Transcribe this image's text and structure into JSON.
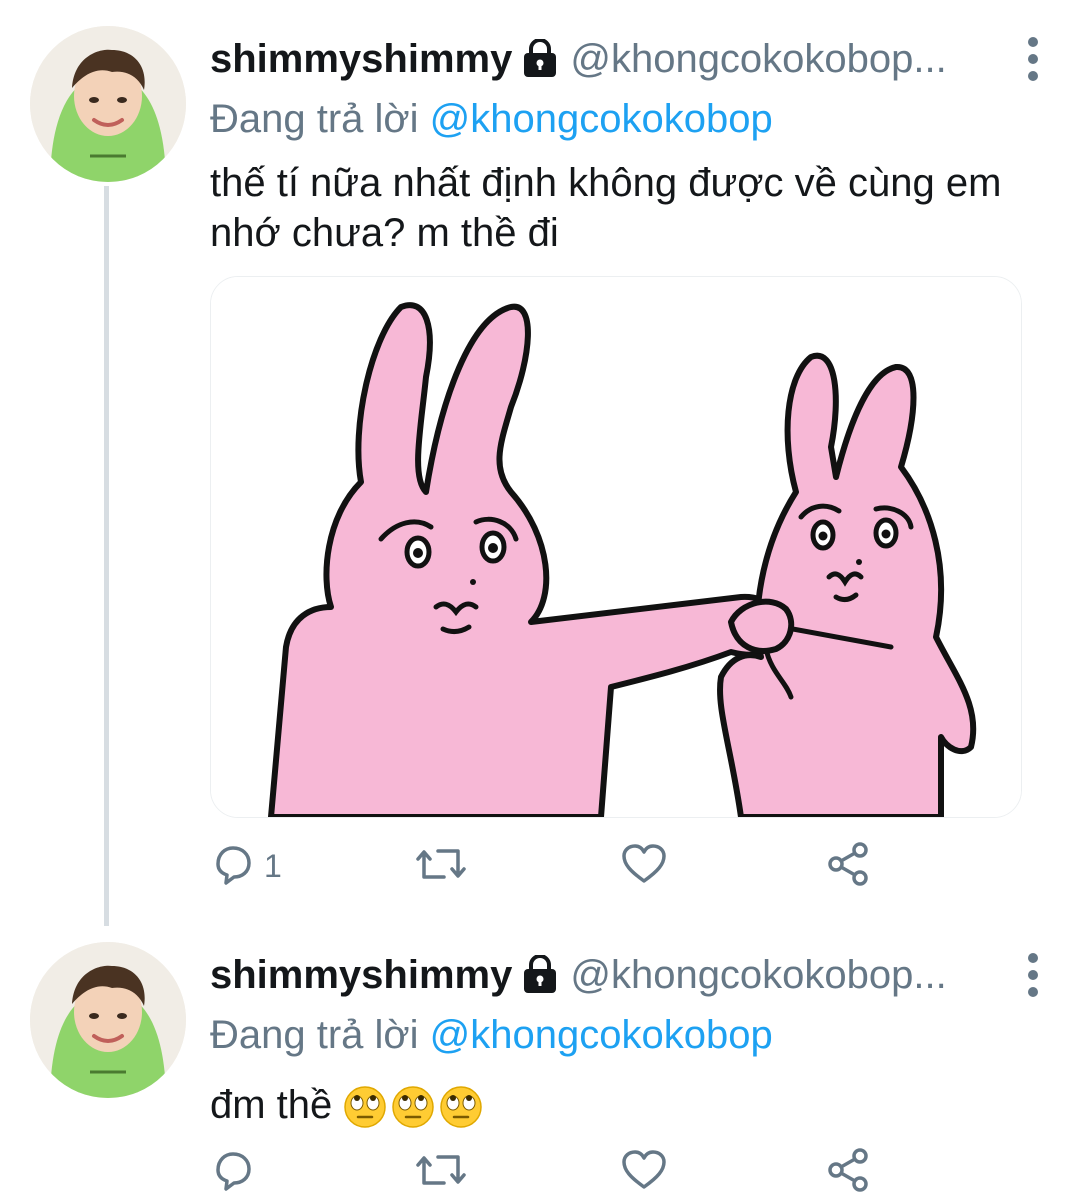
{
  "tweets": [
    {
      "display_name": "shimmyshimmy",
      "handle": "@khongcokokobop...",
      "replying_prefix": "Đang trả lời ",
      "replying_to": "@khongcokokobop",
      "text": "thế tí nữa nhất định không được về cùng em nhớ chưa? m thề đi",
      "reply_count": "1",
      "has_media": true
    },
    {
      "display_name": "shimmyshimmy",
      "handle": "@khongcokokobop...",
      "replying_prefix": "Đang trả lời ",
      "replying_to": "@khongcokokobop",
      "text": "đm thề",
      "emojis": [
        "face-with-rolling-eyes",
        "face-with-rolling-eyes",
        "face-with-rolling-eyes"
      ],
      "reply_count": ""
    }
  ],
  "colors": {
    "accent": "#1da1f2",
    "secondary_text": "#657786",
    "thread_line": "#d7dde2",
    "bunny_pink": "#f7b8d6",
    "hoodie_green": "#8fd46a"
  },
  "icons": [
    "lock-icon",
    "more-vertical-icon",
    "reply-icon",
    "retweet-icon",
    "like-icon",
    "share-icon"
  ]
}
